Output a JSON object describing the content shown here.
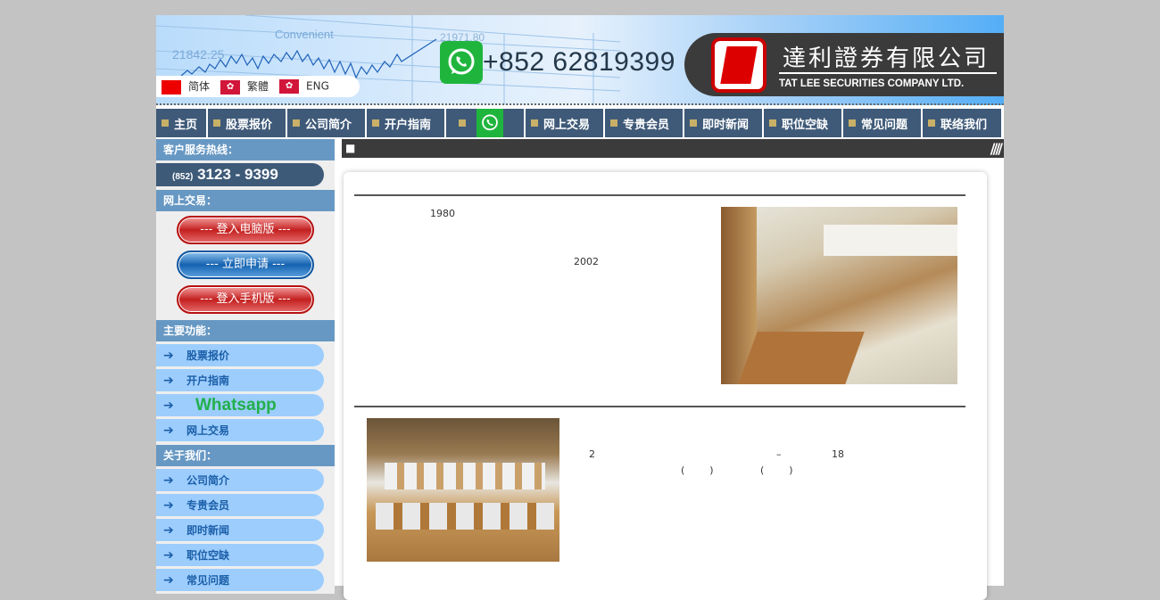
{
  "banner": {
    "tagline": "Convenient",
    "ticker_left": "21842.25",
    "ticker_right": "21971.80",
    "whatsapp_phone": "+852 62819399",
    "company_cn": "達利證券有限公司",
    "company_en": "TAT LEE SECURITIES COMPANY LTD."
  },
  "languages": [
    {
      "label": "简体",
      "flag": "china"
    },
    {
      "label": "繁體",
      "flag": "hong-kong"
    },
    {
      "label": "ENG",
      "flag": "hong-kong"
    }
  ],
  "nav": [
    {
      "label": "主页"
    },
    {
      "label": "股票报价"
    },
    {
      "label": "公司简介"
    },
    {
      "label": "开户指南"
    },
    {
      "label": "",
      "icon": "whatsapp-icon"
    },
    {
      "label": "网上交易"
    },
    {
      "label": "专贵会员"
    },
    {
      "label": "即时新闻"
    },
    {
      "label": "职位空缺"
    },
    {
      "label": "常见问题"
    },
    {
      "label": "联络我们"
    }
  ],
  "sidebar": {
    "hotline_heading": "客户服务热线：",
    "hotline_prefix": "(852)",
    "hotline_number": "3123 - 9399",
    "trading_heading": "网上交易：",
    "buttons": [
      "---  登入电脑版  ---",
      "---  立即申请  ---",
      "---  登入手机版  ---"
    ],
    "main_heading": "主要功能：",
    "main_items": [
      "股票报价",
      "开户指南",
      "Whatsapp",
      "网上交易"
    ],
    "about_heading": "关于我们：",
    "about_items": [
      "公司简介",
      "专贵会员",
      "即时新闻",
      "职位空缺",
      "常见问题"
    ]
  },
  "content": {
    "bar_marker": "■",
    "p1_year": "1980",
    "p1_year2": "2002",
    "p2_a": "2",
    "p2_dash": "–",
    "p2_b": "18",
    "p2_paren1": "(        )",
    "p2_paren2": "(        )"
  },
  "colors": {
    "nav": "#3f5a78",
    "sidebar_heading": "#6798c3",
    "sidebar_item": "#9ccdfd",
    "whatsapp": "#1fb53d",
    "logo_red": "#cc0000"
  }
}
